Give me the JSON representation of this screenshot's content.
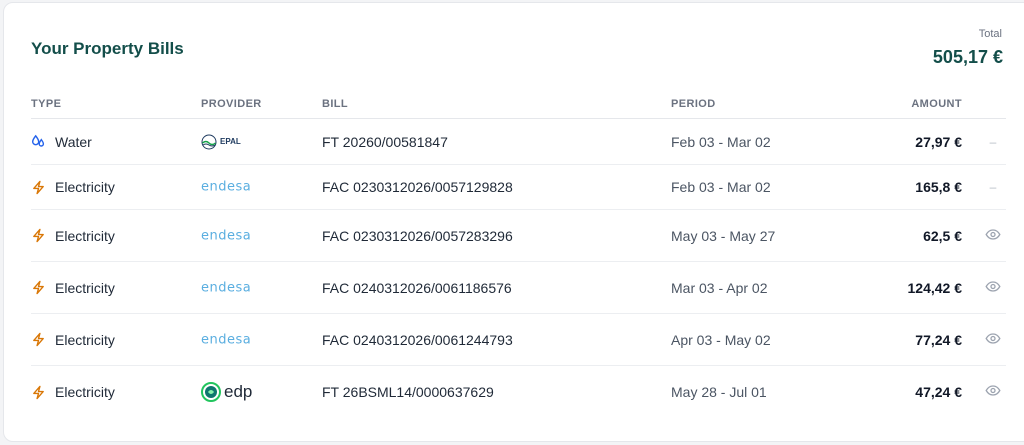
{
  "card": {
    "title": "Your Property Bills",
    "total_label": "Total",
    "total_value": "505,17 €"
  },
  "columns": {
    "type": "TYPE",
    "provider": "PROVIDER",
    "bill": "BILL",
    "period": "PERIOD",
    "amount": "AMOUNT"
  },
  "rows": [
    {
      "type": "Water",
      "type_icon": "water-drop-icon",
      "provider": "EPAL",
      "provider_logo": "epal-logo",
      "bill": "FT 20260/00581847",
      "period": "Feb 03 - Mar 02",
      "amount": "27,97 €",
      "action": "–"
    },
    {
      "type": "Electricity",
      "type_icon": "lightning-icon",
      "provider": "endesa",
      "provider_logo": "endesa-logo",
      "bill": "FAC 0230312026/0057129828",
      "period": "Feb 03 - Mar 02",
      "amount": "165,8 €",
      "action": "–"
    },
    {
      "type": "Electricity",
      "type_icon": "lightning-icon",
      "provider": "endesa",
      "provider_logo": "endesa-logo",
      "bill": "FAC 0230312026/0057283296",
      "period": "May 03 - May 27",
      "amount": "62,5 €",
      "action": "eye-icon"
    },
    {
      "type": "Electricity",
      "type_icon": "lightning-icon",
      "provider": "endesa",
      "provider_logo": "endesa-logo",
      "bill": "FAC 0240312026/0061186576",
      "period": "Mar 03 - Apr 02",
      "amount": "124,42 €",
      "action": "eye-icon"
    },
    {
      "type": "Electricity",
      "type_icon": "lightning-icon",
      "provider": "endesa",
      "provider_logo": "endesa-logo",
      "bill": "FAC 0240312026/0061244793",
      "period": "Apr 03 - May 02",
      "amount": "77,24 €",
      "action": "eye-icon"
    },
    {
      "type": "Electricity",
      "type_icon": "lightning-icon",
      "provider": "edp",
      "provider_logo": "edp-logo",
      "bill": "FT 26BSML14/0000637629",
      "period": "May 28 - Jul 01",
      "amount": "47,24 €",
      "action": "eye-icon"
    }
  ],
  "colors": {
    "title": "#134e4a",
    "water_icon": "#2563eb",
    "electricity_icon": "#d97706",
    "endesa": "#5aaee0",
    "edp": "#22c55e"
  }
}
